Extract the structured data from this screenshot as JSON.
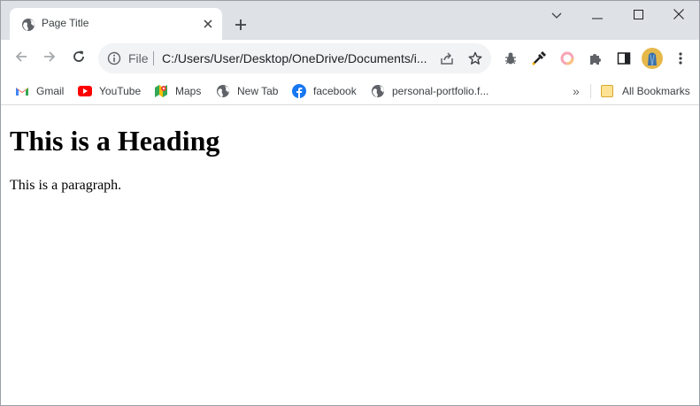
{
  "tab": {
    "title": "Page Title",
    "favicon": "globe-icon"
  },
  "toolbar": {
    "scheme": "File",
    "url": "C:/Users/User/Desktop/OneDrive/Documents/i..."
  },
  "bookmarks": {
    "items": [
      {
        "label": "Gmail",
        "icon": "gmail-icon"
      },
      {
        "label": "YouTube",
        "icon": "youtube-icon"
      },
      {
        "label": "Maps",
        "icon": "maps-icon"
      },
      {
        "label": "New Tab",
        "icon": "globe-icon"
      },
      {
        "label": "facebook",
        "icon": "facebook-icon"
      },
      {
        "label": "personal-portfolio.f...",
        "icon": "globe-icon"
      }
    ],
    "overflow": "»",
    "all_bookmarks": "All Bookmarks"
  },
  "page": {
    "heading": "This is a Heading",
    "paragraph": "This is a paragraph."
  },
  "colors": {
    "tabstrip_bg": "#dee1e6",
    "omnibox_bg": "#f1f3f4",
    "youtube_red": "#ff0000",
    "facebook_blue": "#1877f2"
  }
}
